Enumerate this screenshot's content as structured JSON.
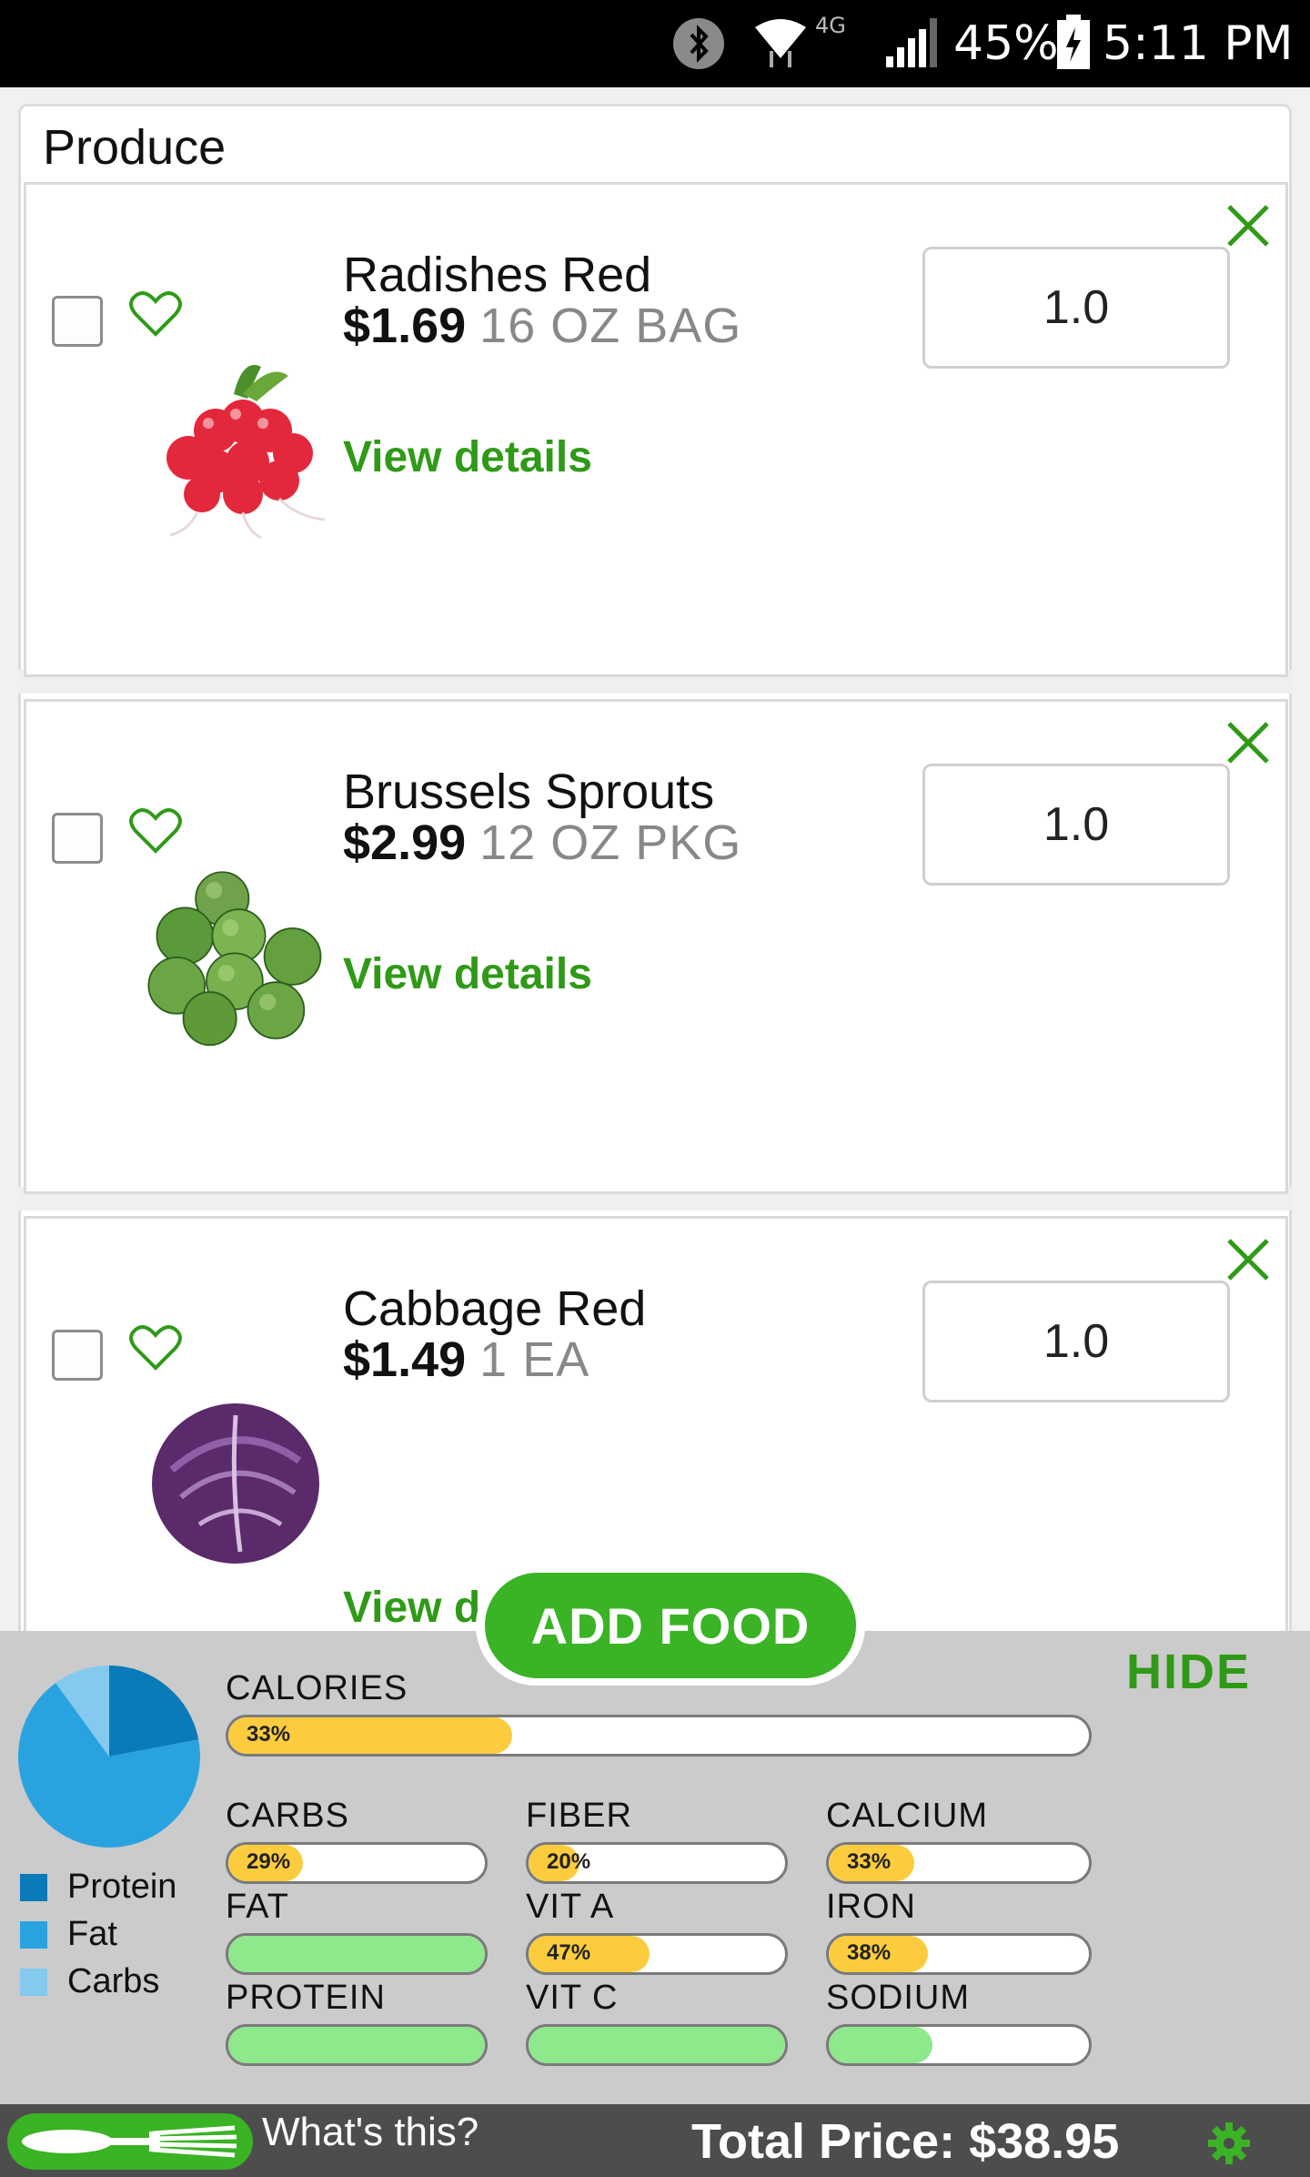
{
  "status_bar": {
    "network": "4G",
    "battery": "45%",
    "time": "5:11 PM"
  },
  "section": {
    "title": "Produce"
  },
  "items": [
    {
      "name": "Radishes Red",
      "price": "$1.69",
      "unit": "16 OZ BAG",
      "details_label": "View details",
      "quantity": "1.0"
    },
    {
      "name": "Brussels Sprouts",
      "price": "$2.99",
      "unit": "12 OZ PKG",
      "details_label": "View details",
      "quantity": "1.0"
    },
    {
      "name": "Cabbage Red",
      "price": "$1.49",
      "unit": "1 EA",
      "details_label": "View details",
      "quantity": "1.0"
    }
  ],
  "add_food_label": "ADD FOOD",
  "nutrition": {
    "hide_label": "HIDE",
    "calories": {
      "label": "CALORIES",
      "percent_text": "33%",
      "value": 0.33
    },
    "nutrients": [
      {
        "label": "CARBS",
        "percent_text": "29%",
        "value": 0.29,
        "color": "yellow"
      },
      {
        "label": "FIBER",
        "percent_text": "20%",
        "value": 0.2,
        "color": "yellow"
      },
      {
        "label": "CALCIUM",
        "percent_text": "33%",
        "value": 0.33,
        "color": "yellow"
      },
      {
        "label": "FAT",
        "percent_text": "",
        "value": 1.0,
        "color": "green"
      },
      {
        "label": "VIT A",
        "percent_text": "47%",
        "value": 0.47,
        "color": "yellow"
      },
      {
        "label": "IRON",
        "percent_text": "38%",
        "value": 0.38,
        "color": "yellow"
      },
      {
        "label": "PROTEIN",
        "percent_text": "",
        "value": 1.0,
        "color": "green"
      },
      {
        "label": "VIT C",
        "percent_text": "",
        "value": 1.0,
        "color": "green"
      },
      {
        "label": "SODIUM",
        "percent_text": "",
        "value": 0.4,
        "color": "green"
      }
    ],
    "legend": [
      {
        "label": "Protein",
        "color": "#0a7ab8"
      },
      {
        "label": "Fat",
        "color": "#29a3e0"
      },
      {
        "label": "Carbs",
        "color": "#84c9ee"
      }
    ]
  },
  "chart_data": {
    "type": "pie",
    "categories": [
      "Protein",
      "Fat",
      "Carbs"
    ],
    "values": [
      0.22,
      0.68,
      0.1
    ]
  },
  "bottom_bar": {
    "whats_this": "What's this?",
    "total_price": "Total Price: $38.95"
  },
  "colors": {
    "accent_green": "#2f9a17",
    "button_green": "#3ab324"
  }
}
